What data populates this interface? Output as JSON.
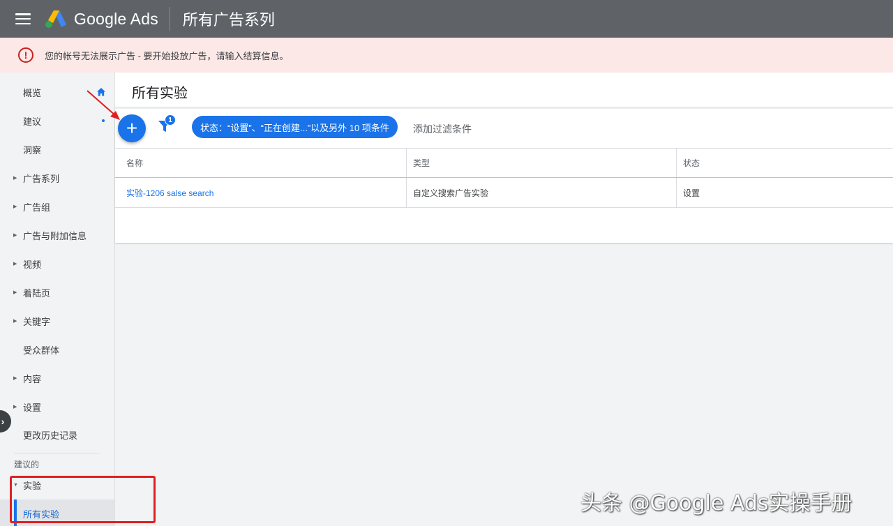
{
  "topbar": {
    "brand": "Google Ads",
    "page_title": "所有广告系列"
  },
  "alert": {
    "message": "您的帐号无法展示广告 - 要开始投放广告，请输入结算信息。",
    "icon": "error-icon",
    "color": "#c5221f"
  },
  "sidebar": {
    "items": [
      {
        "label": "概览",
        "expandable": false
      },
      {
        "label": "建议",
        "expandable": false
      },
      {
        "label": "洞察",
        "expandable": false
      },
      {
        "label": "广告系列",
        "expandable": true
      },
      {
        "label": "广告组",
        "expandable": true
      },
      {
        "label": "广告与附加信息",
        "expandable": true
      },
      {
        "label": "视频",
        "expandable": true
      },
      {
        "label": "着陆页",
        "expandable": true
      },
      {
        "label": "关键字",
        "expandable": true
      },
      {
        "label": "受众群体",
        "expandable": false
      },
      {
        "label": "内容",
        "expandable": true
      },
      {
        "label": "设置",
        "expandable": true
      },
      {
        "label": "更改历史记录",
        "expandable": false
      }
    ],
    "section_label": "建议的",
    "experiments": {
      "label": "实验",
      "expanded": true
    },
    "active_item": "所有实验"
  },
  "main": {
    "title": "所有实验",
    "filter_count": "1",
    "filter_chip": "状态：“设置”、“正在创建...”以及另外 10 项条件",
    "add_filter": "添加过滤条件",
    "table": {
      "headers": [
        "名称",
        "类型",
        "状态"
      ],
      "rows": [
        [
          "实验-1206 salse search",
          "自定义搜索广告实验",
          "设置"
        ]
      ]
    }
  },
  "watermark": "头条 @Google Ads实操手册",
  "colors": {
    "accent": "#1a73e8",
    "topbar": "#5f6368",
    "alert_bg": "#fce8e6",
    "annotation": "#e02020"
  }
}
